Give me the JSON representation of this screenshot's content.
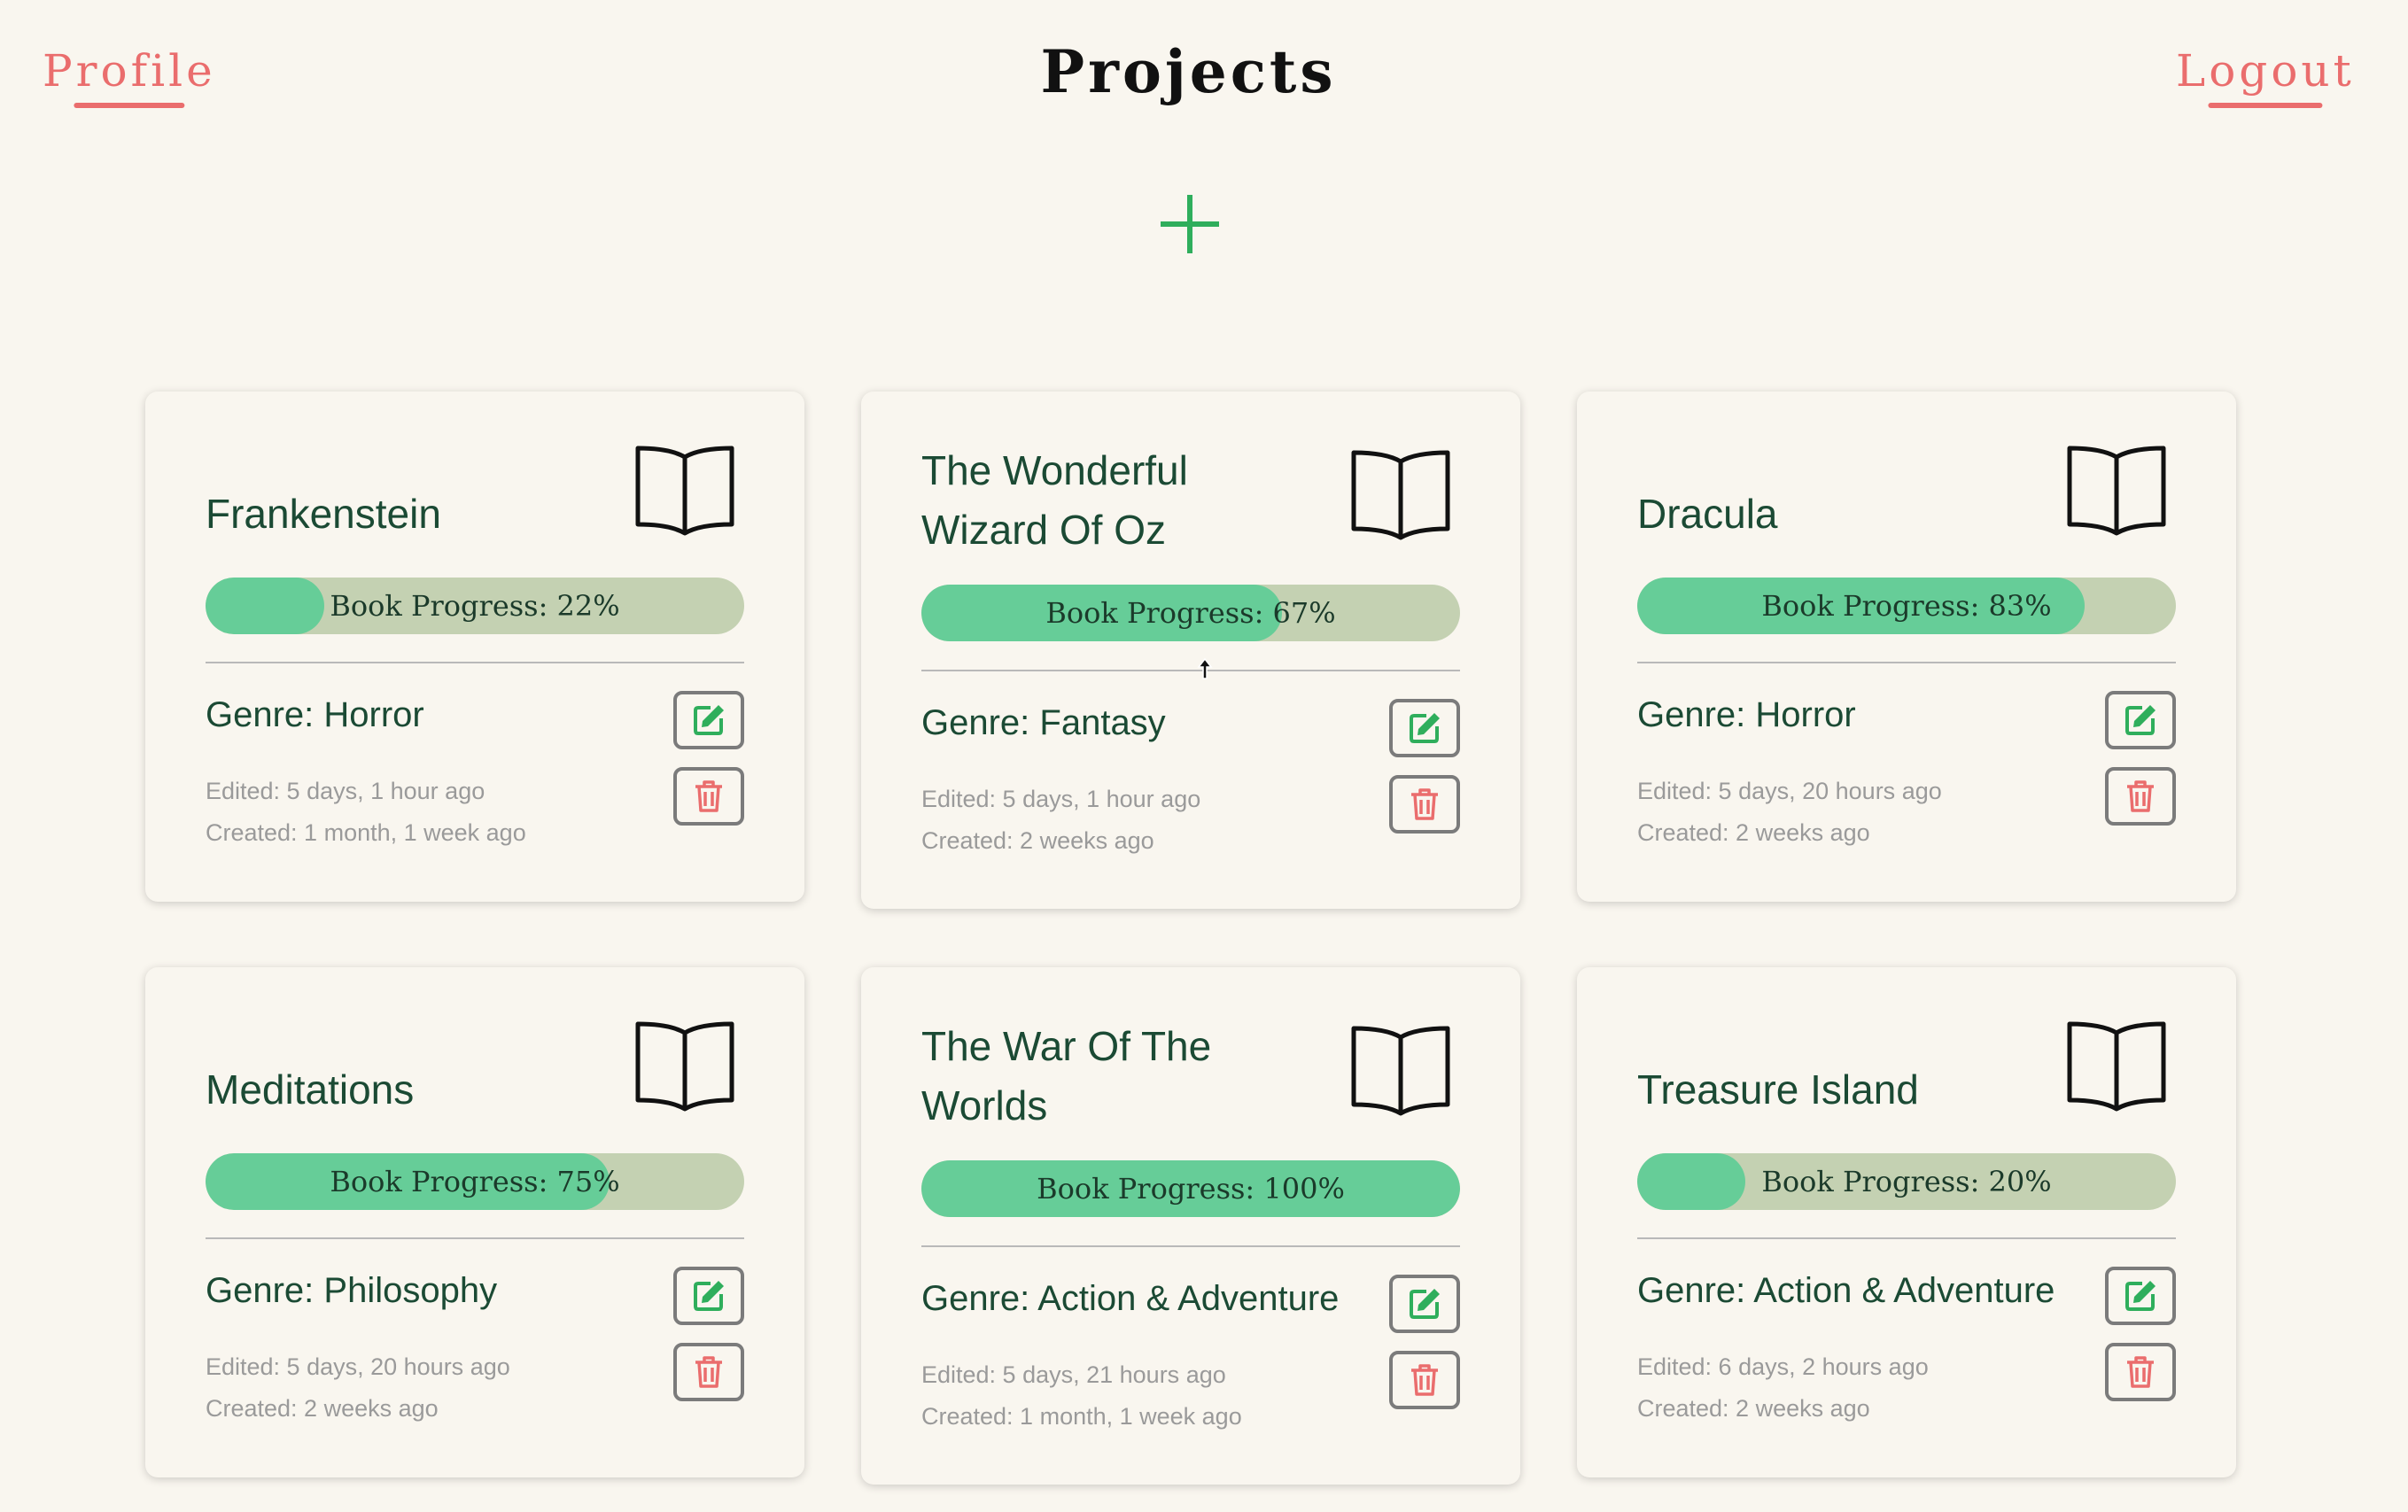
{
  "header": {
    "profile_label": "Profile",
    "title": "Projects",
    "logout_label": "Logout"
  },
  "colors": {
    "background": "#f9f6ef",
    "accent_red": "#ea6d6d",
    "accent_green": "#2fae5c",
    "progress_fill": "#66cd98",
    "progress_track": "#c4d1b2",
    "title_text": "#1b4a34"
  },
  "icons": {
    "add": "plus-icon",
    "book": "open-book-icon",
    "edit": "edit-icon",
    "delete": "trash-icon"
  },
  "projects": [
    {
      "title": "Frankenstein",
      "progress_label": "Book Progress: 22%",
      "progress": 22,
      "genre": "Genre: Horror",
      "edited": "Edited: 5 days, 1 hour ago",
      "created": "Created: 1 month, 1 week ago"
    },
    {
      "title": "The Wonderful Wizard Of Oz",
      "progress_label": "Book Progress: 67%",
      "progress": 67,
      "genre": "Genre: Fantasy",
      "edited": "Edited: 5 days, 1 hour ago",
      "created": "Created: 2 weeks ago"
    },
    {
      "title": "Dracula",
      "progress_label": "Book Progress: 83%",
      "progress": 83,
      "genre": "Genre: Horror",
      "edited": "Edited: 5 days, 20 hours ago",
      "created": "Created: 2 weeks ago"
    },
    {
      "title": "Meditations",
      "progress_label": "Book Progress: 75%",
      "progress": 75,
      "genre": "Genre: Philosophy",
      "edited": "Edited: 5 days, 20 hours ago",
      "created": "Created: 2 weeks ago"
    },
    {
      "title": "The War Of The Worlds",
      "progress_label": "Book Progress: 100%",
      "progress": 100,
      "genre": "Genre: Action & Adventure",
      "edited": "Edited: 5 days, 21 hours ago",
      "created": "Created: 1 month, 1 week ago"
    },
    {
      "title": "Treasure Island",
      "progress_label": "Book Progress: 20%",
      "progress": 20,
      "genre": "Genre: Action & Adventure",
      "edited": "Edited: 6 days, 2 hours ago",
      "created": "Created: 2 weeks ago"
    }
  ]
}
